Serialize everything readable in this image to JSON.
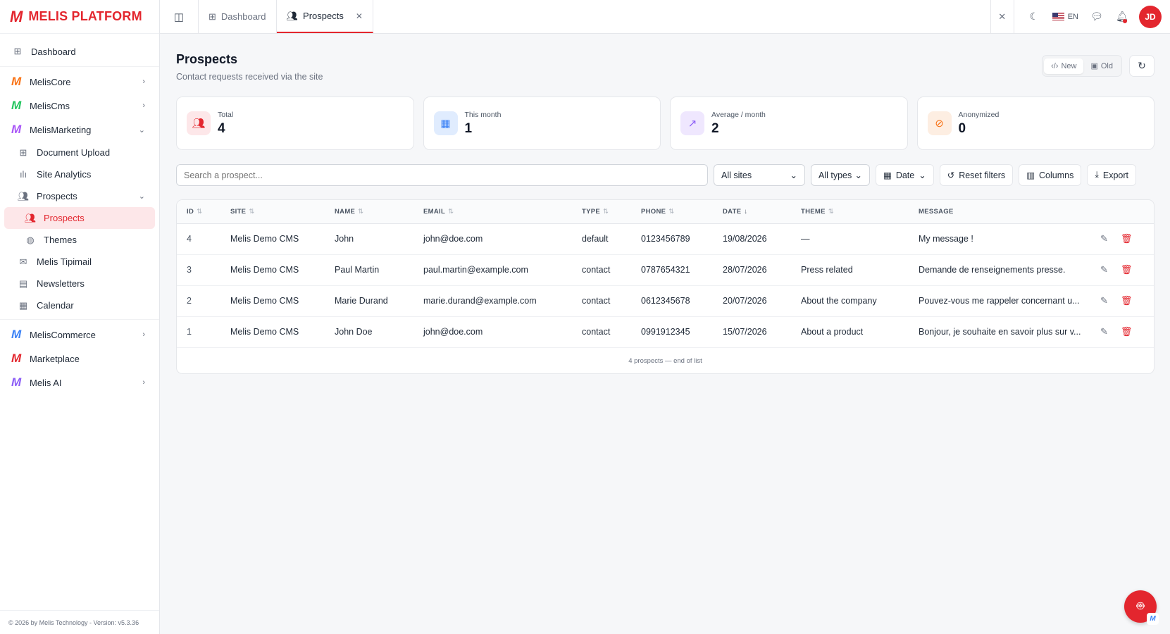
{
  "brand": {
    "logo": "M",
    "name": "MELIS PLATFORM"
  },
  "sidebar": {
    "dashboard": "Dashboard",
    "groups": [
      {
        "label": "MelisCore",
        "color": "#f97316"
      },
      {
        "label": "MelisCms",
        "color": "#22c55e"
      },
      {
        "label": "MelisMarketing",
        "color": "#a855f7"
      }
    ],
    "marketing_items": [
      "Document Upload",
      "Site Analytics",
      "Prospects"
    ],
    "prospects_items": [
      "Prospects",
      "Themes"
    ],
    "more_items": [
      "Melis Tipimail",
      "Newsletters",
      "Calendar"
    ],
    "bottom_groups": [
      {
        "label": "MelisCommerce",
        "color": "#3b82f6"
      },
      {
        "label": "Marketplace",
        "color": "#e3262e"
      },
      {
        "label": "Melis AI",
        "color": "#8b5cf6"
      }
    ],
    "footer": "© 2026 by Melis Technology - Version: v5.3.36"
  },
  "topbar": {
    "tabs": [
      {
        "label": "Dashboard",
        "icon": "grid-icon"
      },
      {
        "label": "Prospects",
        "icon": "users-icon"
      }
    ],
    "lang": "EN",
    "user_initials": "JD"
  },
  "page": {
    "title": "Prospects",
    "subtitle": "Contact requests received via the site",
    "view_new": "New",
    "view_old": "Old"
  },
  "stats": [
    {
      "label": "Total",
      "value": "4",
      "color": "#e3262e",
      "bg": "#fde7e9",
      "icon": "users-icon"
    },
    {
      "label": "This month",
      "value": "1",
      "color": "#3b82f6",
      "bg": "#e0ecfe",
      "icon": "calendar-icon"
    },
    {
      "label": "Average / month",
      "value": "2",
      "color": "#8b5cf6",
      "bg": "#efe7fe",
      "icon": "trend-up-icon"
    },
    {
      "label": "Anonymized",
      "value": "0",
      "color": "#f97316",
      "bg": "#fdeee2",
      "icon": "eye-off-icon"
    }
  ],
  "filters": {
    "search_placeholder": "Search a prospect...",
    "sites": "All sites",
    "types": "All types",
    "date": "Date",
    "reset": "Reset filters",
    "columns": "Columns",
    "export": "Export"
  },
  "table": {
    "headers": [
      "ID",
      "SITE",
      "NAME",
      "EMAIL",
      "TYPE",
      "PHONE",
      "DATE",
      "THEME",
      "MESSAGE"
    ],
    "rows": [
      {
        "id": "4",
        "site": "Melis Demo CMS",
        "name": "John",
        "email": "john@doe.com",
        "type": "default",
        "phone": "0123456789",
        "date": "19/08/2026",
        "theme": "—",
        "message": "My message !"
      },
      {
        "id": "3",
        "site": "Melis Demo CMS",
        "name": "Paul Martin",
        "email": "paul.martin@example.com",
        "type": "contact",
        "phone": "0787654321",
        "date": "28/07/2026",
        "theme": "Press related",
        "message": "Demande de renseignements presse."
      },
      {
        "id": "2",
        "site": "Melis Demo CMS",
        "name": "Marie Durand",
        "email": "marie.durand@example.com",
        "type": "contact",
        "phone": "0612345678",
        "date": "20/07/2026",
        "theme": "About the company",
        "message": "Pouvez-vous me rappeler concernant u..."
      },
      {
        "id": "1",
        "site": "Melis Demo CMS",
        "name": "John Doe",
        "email": "john@doe.com",
        "type": "contact",
        "phone": "0991912345",
        "date": "15/07/2026",
        "theme": "About a product",
        "message": "Bonjour, je souhaite en savoir plus sur v..."
      }
    ],
    "footer": "4 prospects — end of list"
  }
}
